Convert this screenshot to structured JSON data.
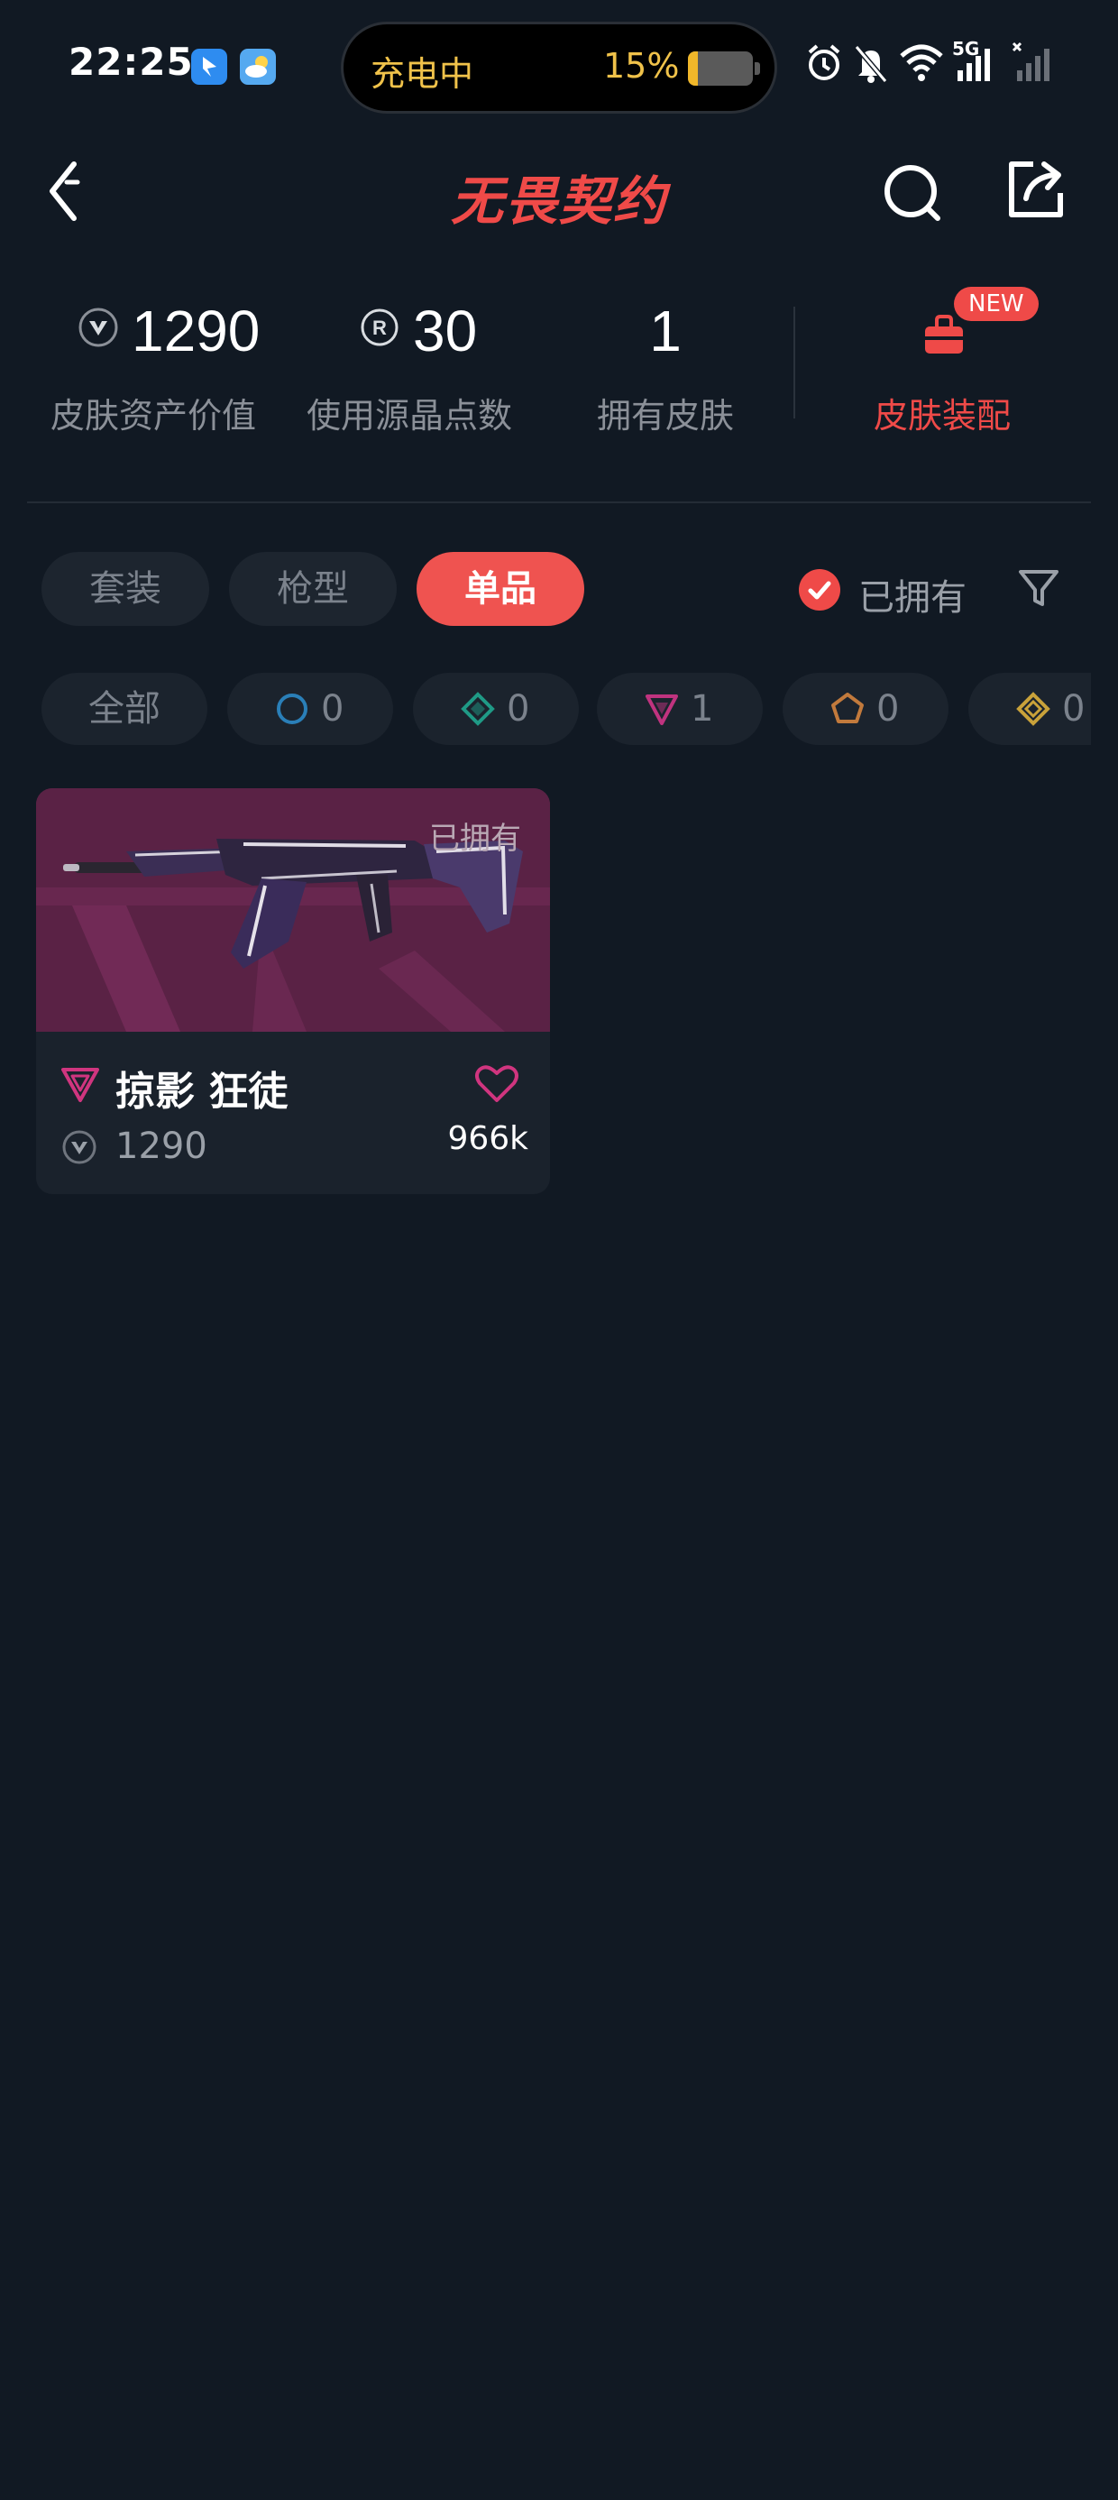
{
  "status_bar": {
    "time": "22:25",
    "charging_label": "充电中",
    "battery_percent": "15%",
    "battery_level": 0.15,
    "network_label": "5G",
    "icons": [
      "app-notification-icon",
      "weather-icon",
      "alarm-icon",
      "mute-icon",
      "wifi-icon",
      "signal-icon",
      "signal-no-sim-icon"
    ]
  },
  "header": {
    "title": "无畏契约",
    "icons": [
      "back-icon",
      "search-icon",
      "share-icon"
    ]
  },
  "stats": {
    "asset_value": "1290",
    "asset_value_label": "皮肤资产价值",
    "radianite_points": "30",
    "radianite_points_label": "使用源晶点数",
    "owned_count": "1",
    "owned_count_label": "拥有皮肤",
    "equip_label": "皮肤装配",
    "new_badge": "NEW"
  },
  "tabs": [
    {
      "label": "套装",
      "active": false
    },
    {
      "label": "枪型",
      "active": false
    },
    {
      "label": "单品",
      "active": true
    }
  ],
  "owned_filter": {
    "label": "已拥有",
    "checked": true
  },
  "rarity_chips": [
    {
      "label": "全部"
    },
    {
      "count": "0",
      "icon": "select-tier-icon",
      "color": "#2a7fb8"
    },
    {
      "count": "0",
      "icon": "deluxe-tier-icon",
      "color": "#1f9a86"
    },
    {
      "count": "1",
      "icon": "premium-tier-icon",
      "color": "#c0337f"
    },
    {
      "count": "0",
      "icon": "exclusive-tier-icon",
      "color": "#c27a3c"
    },
    {
      "count": "0",
      "icon": "ultra-tier-icon",
      "color": "#c9a23a"
    }
  ],
  "card": {
    "owned_tag": "已拥有",
    "name": "掠影 狂徒",
    "price": "1290",
    "likes": "966k",
    "rarity_color": "#d0357f",
    "image_bg": "#5c2447"
  },
  "colors": {
    "accent": "#ef4a48",
    "background": "#111923",
    "chip_bg": "#1b232d"
  }
}
